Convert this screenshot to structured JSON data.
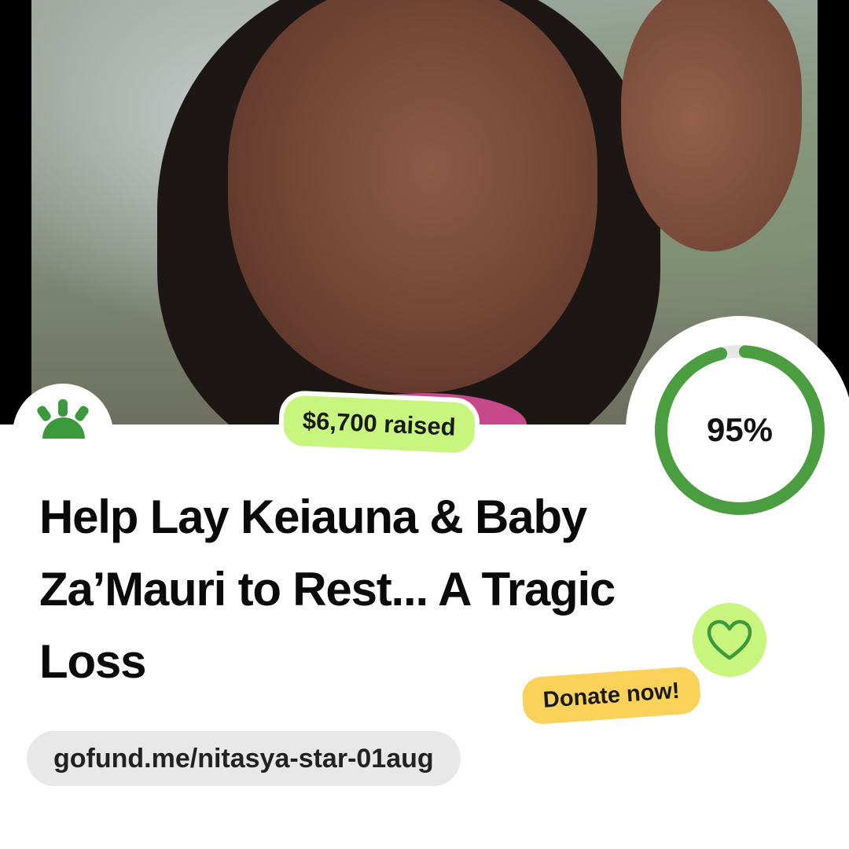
{
  "campaign": {
    "raised_label": "$6,700 raised",
    "progress_percent_label": "95%",
    "progress_fraction": 0.95,
    "title": "Help Lay Keiauna & Baby Za’Mauri to Rest... A Tragic Loss",
    "donate_label": "Donate now!",
    "url": "gofund.me/nitasya-star-01aug"
  },
  "icons": {
    "logo": "gofundme-sunrise-logo-icon",
    "heart": "heart-icon"
  },
  "colors": {
    "brand_green": "#3c9a3c",
    "ring_green": "#4a9e40",
    "lime": "#c7f57d",
    "yellow": "#fad25a",
    "url_pill": "#e8e8e8"
  }
}
